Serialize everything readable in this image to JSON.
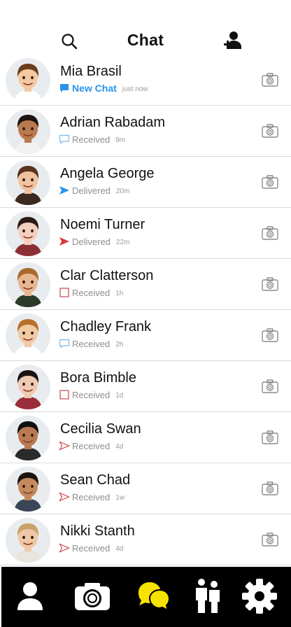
{
  "header": {
    "title": "Chat",
    "search_icon": "search-icon",
    "add_friend_icon": "add-friend-icon"
  },
  "colors": {
    "new_chat_blue": "#2a93e8",
    "received_blue": "#7ab8ea",
    "delivered_blue": "#2a93e8",
    "delivered_red": "#d9383a",
    "received_red": "#c9474a",
    "tabbar_bg": "#000000",
    "chat_tab_yellow": "#f7e300"
  },
  "chats": [
    {
      "name": "Mia Brasil",
      "status": "New Chat",
      "time": "just now",
      "status_icon": "chat-bubble-filled-blue-icon"
    },
    {
      "name": "Adrian Rabadam",
      "status": "Received",
      "time": "9m",
      "status_icon": "chat-bubble-outline-blue-icon"
    },
    {
      "name": "Angela George",
      "status": "Delivered",
      "time": "20m",
      "status_icon": "arrow-filled-blue-icon"
    },
    {
      "name": "Noemi Turner",
      "status": "Delivered",
      "time": "22m",
      "status_icon": "arrow-filled-red-icon"
    },
    {
      "name": "Clar Clatterson",
      "status": "Received",
      "time": "1h",
      "status_icon": "square-outline-red-icon"
    },
    {
      "name": "Chadley Frank",
      "status": "Received",
      "time": "2h",
      "status_icon": "chat-bubble-outline-blue-icon"
    },
    {
      "name": "Bora Bimble",
      "status": "Received",
      "time": "1d",
      "status_icon": "square-outline-red-icon"
    },
    {
      "name": "Cecilia Swan",
      "status": "Received",
      "time": "4d",
      "status_icon": "arrow-outline-red-icon"
    },
    {
      "name": "Sean Chad",
      "status": "Received",
      "time": "1w",
      "status_icon": "arrow-outline-red-icon"
    },
    {
      "name": "Nikki Stanth",
      "status": "Received",
      "time": "4d",
      "status_icon": "arrow-outline-red-icon"
    }
  ],
  "tabbar": {
    "items": [
      "profile-icon",
      "camera-icon",
      "chat-icon",
      "friends-icon",
      "settings-icon"
    ],
    "active": "chat-icon"
  }
}
